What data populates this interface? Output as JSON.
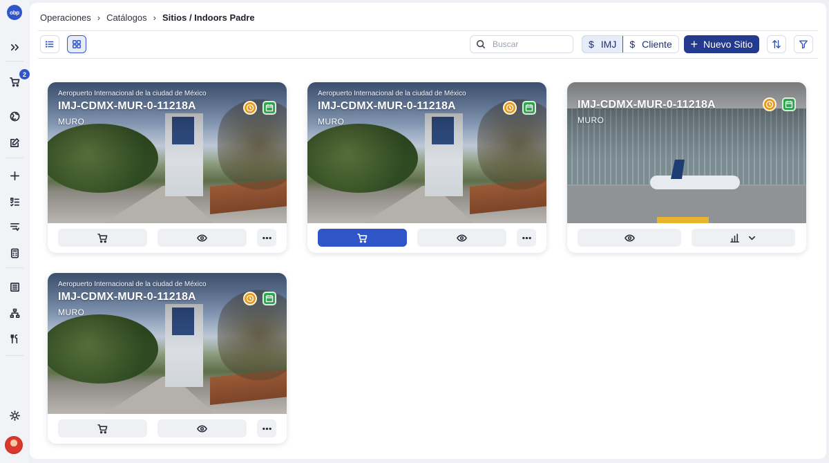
{
  "brand": {
    "logo_text": "obp",
    "accent": "#2f55c9"
  },
  "sidebar": {
    "cart_count": "2",
    "icons": [
      "expand-icon",
      "cart-icon",
      "globe-icon",
      "edit-icon",
      "plus-icon",
      "list-check-icon",
      "filter-list-icon",
      "calculator-icon",
      "table-icon",
      "hierarchy-icon",
      "tools-icon",
      "sun-icon"
    ]
  },
  "breadcrumb": {
    "items": [
      "Operaciones",
      "Catálogos"
    ],
    "current": "Sitios / Indoors Padre"
  },
  "toolbar": {
    "search_placeholder": "Buscar",
    "currency_options": [
      {
        "symbol": "$",
        "label": "IMJ",
        "active": true
      },
      {
        "symbol": "$",
        "label": "Cliente",
        "active": false
      }
    ],
    "new_button": "Nuevo Sitio"
  },
  "cards": [
    {
      "subtitle": "Aeropuerto Internacional de la ciudad de México",
      "title": "IMJ-CDMX-MUR-0-11218A",
      "type": "MURO",
      "image": "street",
      "cart_active": false
    },
    {
      "subtitle": "Aeropuerto Internacional de la ciudad de México",
      "title": "IMJ-CDMX-MUR-0-11218A",
      "type": "MURO",
      "image": "street",
      "cart_active": true
    },
    {
      "subtitle": "",
      "title": "IMJ-CDMX-MUR-0-11218A",
      "type": "MURO",
      "image": "airport",
      "cart_active": false
    },
    {
      "subtitle": "Aeropuerto Internacional de la ciudad de México",
      "title": "IMJ-CDMX-MUR-0-11218A",
      "type": "MURO",
      "image": "street",
      "cart_active": false
    }
  ]
}
